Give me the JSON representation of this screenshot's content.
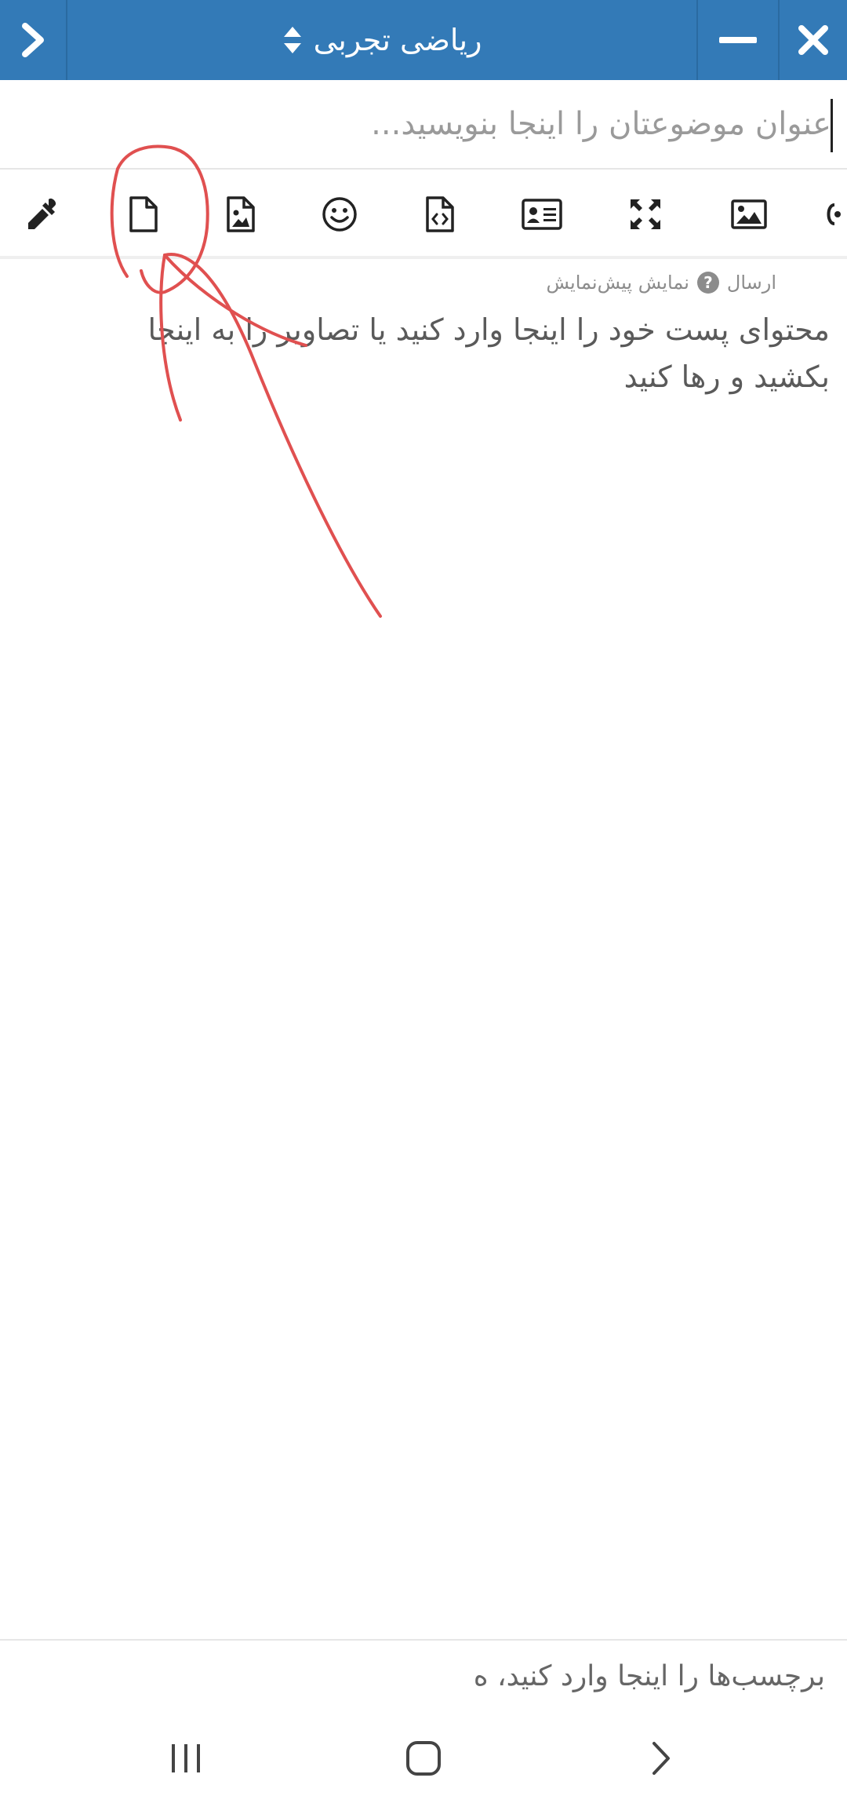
{
  "header": {
    "title": "ریاضی تجربی",
    "background": "#337ab7",
    "icons": {
      "back": "chevron-right-icon",
      "sort": "sort-arrows-icon",
      "minimize": "minus-icon",
      "close": "close-icon"
    }
  },
  "topic": {
    "title_placeholder": "عنوان موضوعتان را اینجا بنویسید...",
    "title_value": ""
  },
  "toolbar": {
    "tools": [
      "color-picker-icon",
      "file-icon",
      "image-file-icon",
      "emoji-icon",
      "code-file-icon",
      "contact-card-icon",
      "fullscreen-icon",
      "picture-icon",
      "overflow-icon"
    ]
  },
  "editor": {
    "preview_label": "ارسال",
    "help_glyph": "?",
    "preview_text": "نمایش پیش‌نمایش",
    "placeholder": "محتوای پست خود را اینجا وارد کنید یا تصاویر را به اینجا بکشید و رها کنید"
  },
  "tags": {
    "placeholder": "برچسب‌ها را اینجا وارد کنید، ه"
  },
  "navigation": {
    "buttons": [
      "recent-apps-icon",
      "home-icon",
      "back-icon"
    ]
  },
  "annotation": {
    "color": "#e05050"
  }
}
